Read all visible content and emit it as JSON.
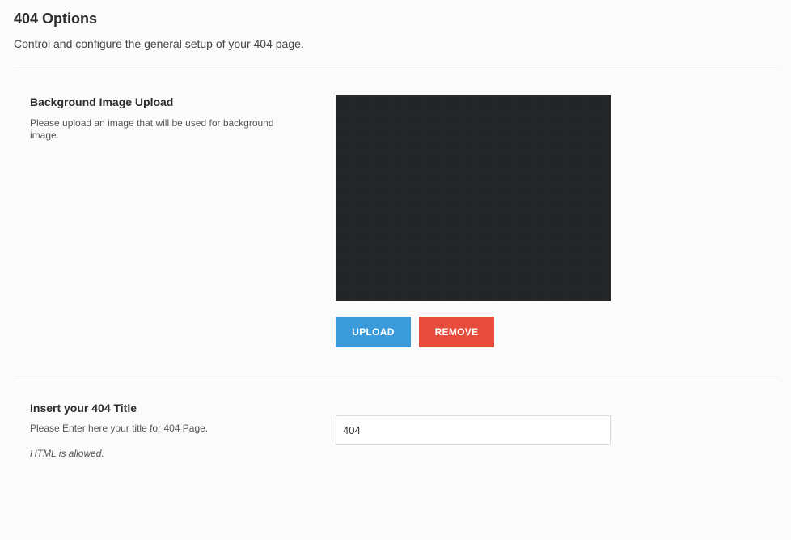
{
  "header": {
    "title": "404 Options",
    "description": "Control and configure the general setup of your 404 page."
  },
  "background_section": {
    "title": "Background Image Upload",
    "description": "Please upload an image that will be used for background image.",
    "upload_label": "UPLOAD",
    "remove_label": "REMOVE",
    "preview_color": "#232527"
  },
  "title_section": {
    "title": "Insert your 404 Title",
    "description": "Please Enter here your title for 404 Page.",
    "note": "HTML is allowed.",
    "input_value": "404"
  },
  "colors": {
    "upload_button": "#3b9ad9",
    "remove_button": "#e74c3c",
    "background": "#fbfbfb"
  }
}
